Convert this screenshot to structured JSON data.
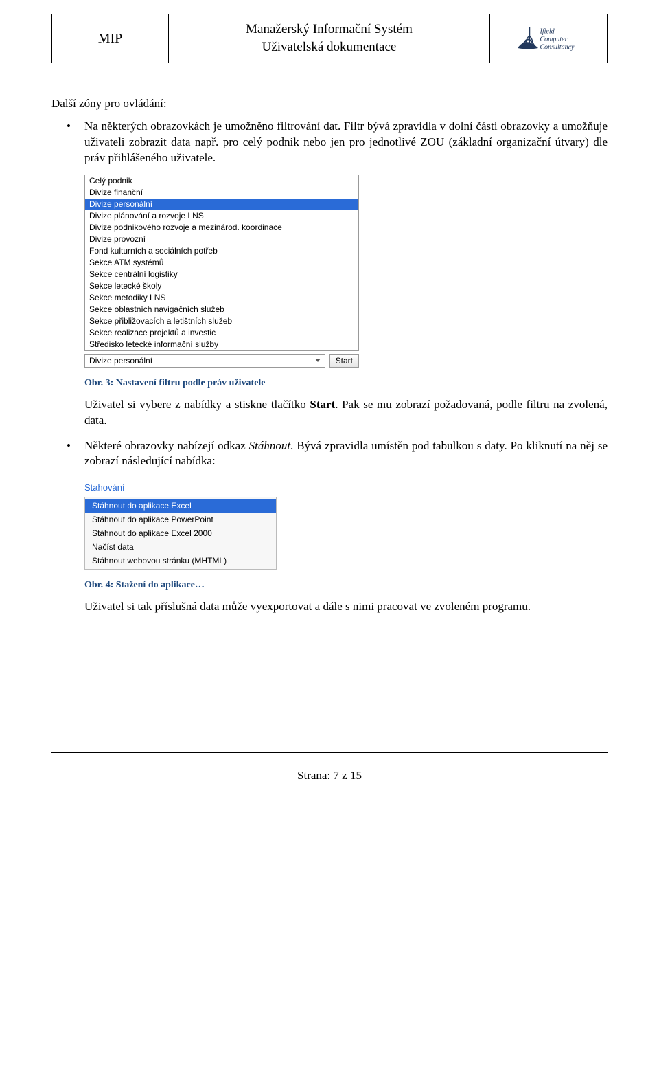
{
  "header": {
    "left": "MIP",
    "center_line1": "Manažerský Informační Systém",
    "center_line2": "Uživatelská dokumentace",
    "logo_line1": "Ifield",
    "logo_line2": "Computer",
    "logo_line3": "Consultancy"
  },
  "intro": "Další zóny pro ovládání:",
  "bullet1": "Na některých obrazovkách je umožněno filtrování dat. Filtr bývá zpravidla v dolní části obrazovky a umožňuje uživateli zobrazit data např. pro celý podnik nebo jen pro jednotlivé ZOU (základní organizační útvary) dle práv přihlášeného uživatele.",
  "fig3": {
    "listbox": [
      {
        "label": "Celý podnik",
        "selected": false
      },
      {
        "label": "Divize finanční",
        "selected": false
      },
      {
        "label": "Divize personální",
        "selected": true
      },
      {
        "label": "Divize plánování a rozvoje LNS",
        "selected": false
      },
      {
        "label": "Divize podnikového rozvoje a mezinárod. koordinace",
        "selected": false
      },
      {
        "label": "Divize provozní",
        "selected": false
      },
      {
        "label": "Fond kulturních a sociálních potřeb",
        "selected": false
      },
      {
        "label": "Sekce ATM systémů",
        "selected": false
      },
      {
        "label": "Sekce centrální logistiky",
        "selected": false
      },
      {
        "label": "Sekce letecké školy",
        "selected": false
      },
      {
        "label": "Sekce metodiky LNS",
        "selected": false
      },
      {
        "label": "Sekce oblastních navigačních služeb",
        "selected": false
      },
      {
        "label": "Sekce přibližovacích a letištních služeb",
        "selected": false
      },
      {
        "label": "Sekce realizace projektů a investic",
        "selected": false
      },
      {
        "label": "Středisko letecké informační služby",
        "selected": false
      }
    ],
    "select_value": "Divize personální",
    "start_button": "Start",
    "caption": "Obr. 3: Nastavení filtru podle práv uživatele"
  },
  "after_fig3_a": "Uživatel si vybere z nabídky a stiskne tlačítko ",
  "after_fig3_bold": "Start",
  "after_fig3_b": ". Pak se mu zobrazí požadovaná, podle filtru na zvolená, data.",
  "bullet2_a": "Některé obrazovky nabízejí odkaz ",
  "bullet2_it": "Stáhnout",
  "bullet2_b": ". Bývá zpravidla umístěn pod tabulkou s daty. Po kliknutí na něj se zobrazí následující nabídka:",
  "fig4": {
    "title": "Stahování",
    "menu": [
      {
        "label": "Stáhnout do aplikace Excel",
        "selected": true
      },
      {
        "label": "Stáhnout do aplikace PowerPoint",
        "selected": false
      },
      {
        "label": "Stáhnout do aplikace Excel 2000",
        "selected": false
      },
      {
        "label": "Načíst data",
        "selected": false
      },
      {
        "label": "Stáhnout webovou stránku (MHTML)",
        "selected": false
      }
    ],
    "caption": "Obr. 4: Stažení do aplikace…"
  },
  "closing": "Uživatel si tak příslušná data může vyexportovat a dále s nimi pracovat ve zvoleném programu.",
  "footer": "Strana:  7 z 15"
}
